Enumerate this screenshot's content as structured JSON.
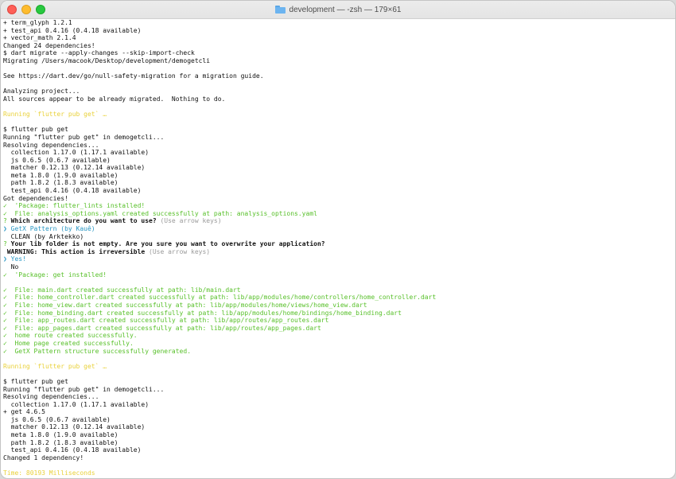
{
  "window": {
    "title": "development — -zsh — 179×61"
  },
  "terminal": {
    "lines": [
      {
        "segments": [
          {
            "t": "+ term_glyph 1.2.1"
          }
        ]
      },
      {
        "segments": [
          {
            "t": "+ test_api 0.4.16 (0.4.18 available)"
          }
        ]
      },
      {
        "segments": [
          {
            "t": "+ vector_math 2.1.4"
          }
        ]
      },
      {
        "segments": [
          {
            "t": "Changed 24 dependencies!"
          }
        ]
      },
      {
        "segments": [
          {
            "t": "$ dart migrate --apply-changes --skip-import-check"
          }
        ]
      },
      {
        "segments": [
          {
            "t": "Migrating /Users/macook/Desktop/development/demogetcli"
          }
        ]
      },
      {
        "segments": []
      },
      {
        "segments": [
          {
            "t": "See https://dart.dev/go/null-safety-migration for a migration guide."
          }
        ]
      },
      {
        "segments": []
      },
      {
        "segments": [
          {
            "t": "Analyzing project..."
          }
        ]
      },
      {
        "segments": [
          {
            "t": "All sources appear to be already migrated.  Nothing to do."
          }
        ]
      },
      {
        "segments": []
      },
      {
        "segments": [
          {
            "t": "Running `flutter pub get` …",
            "c": "yellow"
          }
        ]
      },
      {
        "segments": []
      },
      {
        "segments": [
          {
            "t": "$ flutter pub get"
          }
        ]
      },
      {
        "segments": [
          {
            "t": "Running \"flutter pub get\" in demogetcli..."
          }
        ]
      },
      {
        "segments": [
          {
            "t": "Resolving dependencies..."
          }
        ]
      },
      {
        "segments": [
          {
            "t": "  collection 1.17.0 (1.17.1 available)"
          }
        ]
      },
      {
        "segments": [
          {
            "t": "  js 0.6.5 (0.6.7 available)"
          }
        ]
      },
      {
        "segments": [
          {
            "t": "  matcher 0.12.13 (0.12.14 available)"
          }
        ]
      },
      {
        "segments": [
          {
            "t": "  meta 1.8.0 (1.9.0 available)"
          }
        ]
      },
      {
        "segments": [
          {
            "t": "  path 1.8.2 (1.8.3 available)"
          }
        ]
      },
      {
        "segments": [
          {
            "t": "  test_api 0.4.16 (0.4.18 available)"
          }
        ]
      },
      {
        "segments": [
          {
            "t": "Got dependencies!"
          }
        ]
      },
      {
        "segments": [
          {
            "t": "✓  'Package: flutter_lints installed!",
            "c": "green"
          }
        ]
      },
      {
        "segments": [
          {
            "t": "✓  File: analysis_options.yaml created successfully at path: analysis_options.yaml",
            "c": "green"
          }
        ]
      },
      {
        "segments": [
          {
            "t": "? ",
            "c": "green"
          },
          {
            "t": "Which architecture do you want to use? ",
            "b": true
          },
          {
            "t": "(Use arrow keys)",
            "c": "gray"
          }
        ]
      },
      {
        "segments": [
          {
            "t": "❯ GetX Pattern (by Kauê)",
            "c": "cyan"
          }
        ]
      },
      {
        "segments": [
          {
            "t": "  CLEAN (by Arktekko)"
          }
        ]
      },
      {
        "segments": [
          {
            "t": "? ",
            "c": "green"
          },
          {
            "t": "Your lib folder is not empty. Are you sure you want to overwrite your application?",
            "b": true
          }
        ]
      },
      {
        "segments": [
          {
            "t": " WARNING: This action is irreversible ",
            "b": true
          },
          {
            "t": "(Use arrow keys)",
            "c": "gray"
          }
        ]
      },
      {
        "segments": [
          {
            "t": "❯ Yes!",
            "c": "cyan"
          }
        ]
      },
      {
        "segments": [
          {
            "t": "  No"
          }
        ]
      },
      {
        "segments": [
          {
            "t": "✓  'Package: get installed!",
            "c": "green"
          }
        ]
      },
      {
        "segments": []
      },
      {
        "segments": [
          {
            "t": "✓  File: main.dart created successfully at path: lib/main.dart",
            "c": "green"
          }
        ]
      },
      {
        "segments": [
          {
            "t": "✓  File: home_controller.dart created successfully at path: lib/app/modules/home/controllers/home_controller.dart",
            "c": "green"
          }
        ]
      },
      {
        "segments": [
          {
            "t": "✓  File: home_view.dart created successfully at path: lib/app/modules/home/views/home_view.dart",
            "c": "green"
          }
        ]
      },
      {
        "segments": [
          {
            "t": "✓  File: home_binding.dart created successfully at path: lib/app/modules/home/bindings/home_binding.dart",
            "c": "green"
          }
        ]
      },
      {
        "segments": [
          {
            "t": "✓  File: app_routes.dart created successfully at path: lib/app/routes/app_routes.dart",
            "c": "green"
          }
        ]
      },
      {
        "segments": [
          {
            "t": "✓  File: app_pages.dart created successfully at path: lib/app/routes/app_pages.dart",
            "c": "green"
          }
        ]
      },
      {
        "segments": [
          {
            "t": "✓  home route created successfully.",
            "c": "green"
          }
        ]
      },
      {
        "segments": [
          {
            "t": "✓  Home page created successfully.",
            "c": "green"
          }
        ]
      },
      {
        "segments": [
          {
            "t": "✓  GetX Pattern structure successfully generated.",
            "c": "green"
          }
        ]
      },
      {
        "segments": []
      },
      {
        "segments": [
          {
            "t": "Running `flutter pub get` …",
            "c": "yellow"
          }
        ]
      },
      {
        "segments": []
      },
      {
        "segments": [
          {
            "t": "$ flutter pub get"
          }
        ]
      },
      {
        "segments": [
          {
            "t": "Running \"flutter pub get\" in demogetcli..."
          }
        ]
      },
      {
        "segments": [
          {
            "t": "Resolving dependencies..."
          }
        ]
      },
      {
        "segments": [
          {
            "t": "  collection 1.17.0 (1.17.1 available)"
          }
        ]
      },
      {
        "segments": [
          {
            "t": "+ get 4.6.5"
          }
        ]
      },
      {
        "segments": [
          {
            "t": "  js 0.6.5 (0.6.7 available)"
          }
        ]
      },
      {
        "segments": [
          {
            "t": "  matcher 0.12.13 (0.12.14 available)"
          }
        ]
      },
      {
        "segments": [
          {
            "t": "  meta 1.8.0 (1.9.0 available)"
          }
        ]
      },
      {
        "segments": [
          {
            "t": "  path 1.8.2 (1.8.3 available)"
          }
        ]
      },
      {
        "segments": [
          {
            "t": "  test_api 0.4.16 (0.4.18 available)"
          }
        ]
      },
      {
        "segments": [
          {
            "t": "Changed 1 dependency!"
          }
        ]
      },
      {
        "segments": []
      },
      {
        "segments": [
          {
            "t": "Time: 80193 Milliseconds",
            "c": "yellow"
          }
        ]
      }
    ]
  }
}
